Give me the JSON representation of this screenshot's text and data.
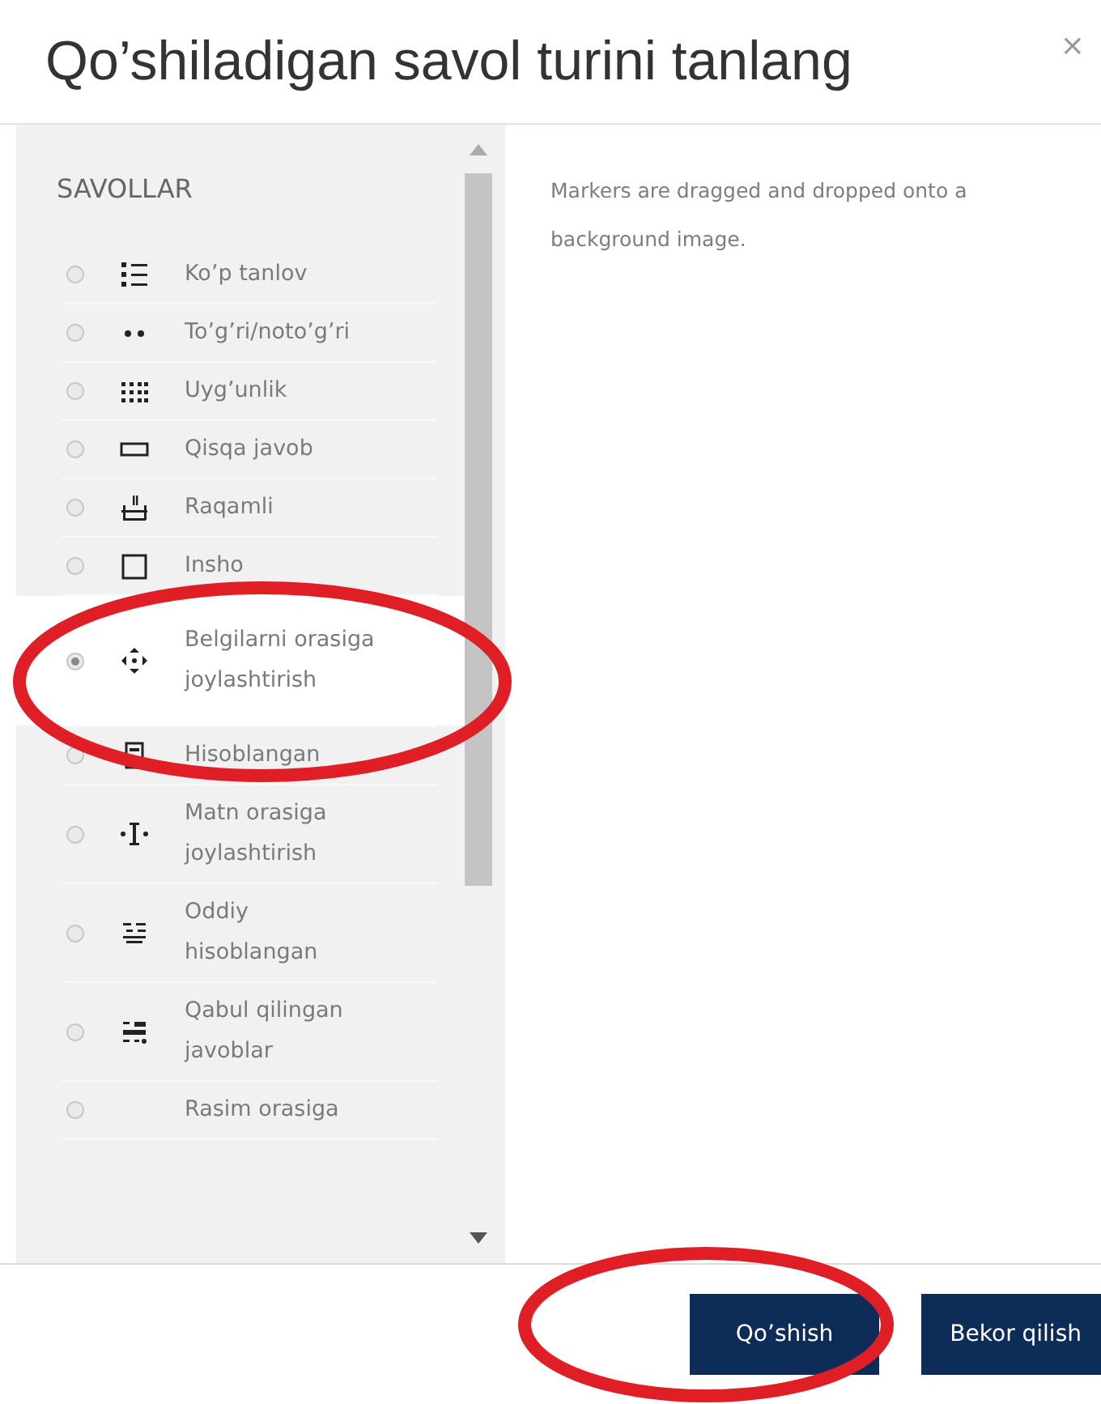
{
  "dialog": {
    "title": "Qo’shiladigan savol turini tanlang",
    "close": "×"
  },
  "list": {
    "heading": "SAVOLLAR",
    "items": [
      {
        "label": "Ko’p tanlov",
        "selected": false
      },
      {
        "label": "To’g’ri/noto’g’ri",
        "selected": false
      },
      {
        "label": "Uyg’unlik",
        "selected": false
      },
      {
        "label": "Qisqa javob",
        "selected": false
      },
      {
        "label": "Raqamli",
        "selected": false
      },
      {
        "label": "Insho",
        "selected": false
      },
      {
        "label": "Belgilarni orasiga joylashtirish",
        "selected": true
      },
      {
        "label": "Hisoblangan",
        "selected": false
      },
      {
        "label": "Matn orasiga joylashtirish",
        "selected": false
      },
      {
        "label": "Oddiy hisoblangan",
        "selected": false
      },
      {
        "label": "Qabul qilingan javoblar",
        "selected": false
      },
      {
        "label": "Rasim orasiga",
        "selected": false
      }
    ]
  },
  "description": "Markers are dragged and dropped onto a background image.",
  "buttons": [
    {
      "label": "Qo’shish"
    },
    {
      "label": "Bekor qilish"
    }
  ]
}
